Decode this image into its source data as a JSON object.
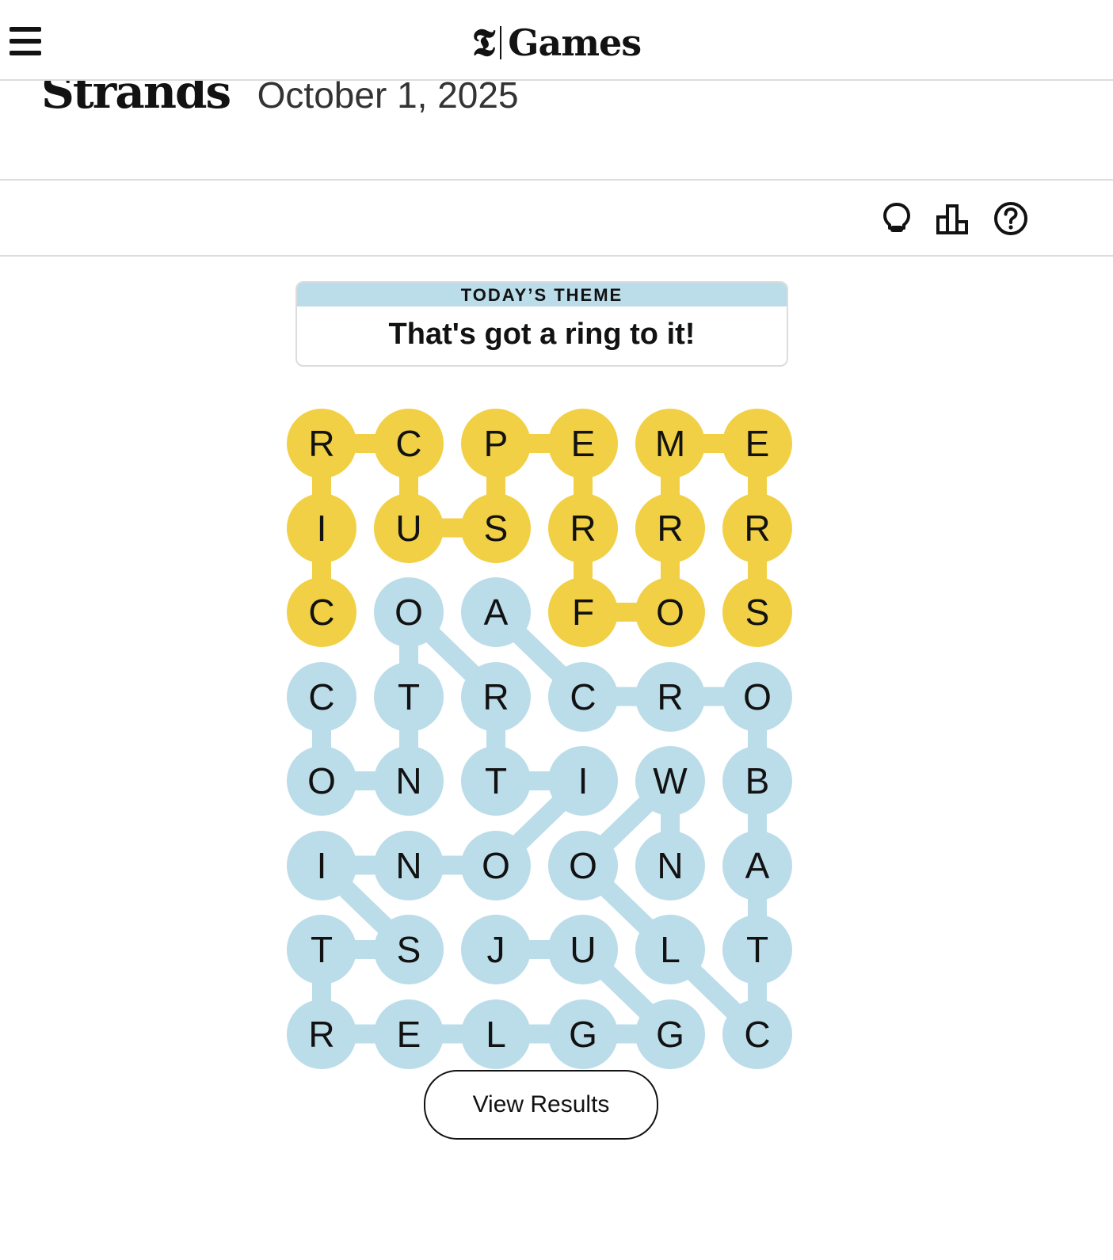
{
  "header": {
    "brand_mark": "𝕿",
    "brand_name": "Games",
    "menu_icon": "hamburger-menu-icon"
  },
  "game": {
    "title": "Strands",
    "date": "October 1, 2025"
  },
  "toolbar": {
    "icons": [
      "hint-lightbulb-icon",
      "stats-podium-icon",
      "help-question-icon"
    ]
  },
  "theme": {
    "label": "TODAY’S THEME",
    "text": "That's got a ring to it!"
  },
  "grid": {
    "rows": [
      [
        "R",
        "C",
        "P",
        "E",
        "M",
        "E"
      ],
      [
        "I",
        "U",
        "S",
        "R",
        "R",
        "R"
      ],
      [
        "C",
        "O",
        "A",
        "F",
        "O",
        "S"
      ],
      [
        "C",
        "T",
        "R",
        "C",
        "R",
        "O"
      ],
      [
        "O",
        "N",
        "T",
        "I",
        "W",
        "B"
      ],
      [
        "I",
        "N",
        "O",
        "O",
        "N",
        "A"
      ],
      [
        "T",
        "S",
        "J",
        "U",
        "L",
        "T"
      ],
      [
        "R",
        "E",
        "L",
        "G",
        "G",
        "C"
      ]
    ],
    "found_words": [
      {
        "type": "spangram",
        "path": [
          [
            2,
            0
          ],
          [
            1,
            0
          ],
          [
            0,
            0
          ],
          [
            0,
            1
          ],
          [
            1,
            1
          ],
          [
            1,
            2
          ],
          [
            0,
            2
          ],
          [
            0,
            3
          ],
          [
            1,
            3
          ],
          [
            2,
            3
          ],
          [
            2,
            4
          ],
          [
            1,
            4
          ],
          [
            0,
            4
          ],
          [
            0,
            5
          ],
          [
            1,
            5
          ],
          [
            2,
            5
          ]
        ]
      },
      {
        "type": "theme",
        "path": [
          [
            3,
            0
          ],
          [
            4,
            0
          ],
          [
            4,
            1
          ],
          [
            3,
            1
          ],
          [
            2,
            1
          ],
          [
            3,
            2
          ],
          [
            4,
            2
          ],
          [
            4,
            3
          ],
          [
            5,
            2
          ],
          [
            5,
            1
          ],
          [
            5,
            0
          ],
          [
            6,
            1
          ],
          [
            6,
            0
          ],
          [
            7,
            0
          ]
        ]
      },
      {
        "type": "theme",
        "path": [
          [
            2,
            2
          ],
          [
            3,
            3
          ],
          [
            3,
            4
          ],
          [
            3,
            5
          ],
          [
            4,
            5
          ],
          [
            5,
            5
          ],
          [
            6,
            5
          ],
          [
            7,
            5
          ]
        ]
      },
      {
        "type": "theme",
        "path": [
          [
            4,
            4
          ],
          [
            5,
            3
          ],
          [
            6,
            4
          ],
          [
            7,
            5
          ]
        ]
      },
      {
        "type": "theme",
        "path": [
          [
            7,
            0
          ],
          [
            7,
            1
          ],
          [
            7,
            2
          ],
          [
            7,
            3
          ],
          [
            7,
            4
          ]
        ]
      },
      {
        "type": "theme",
        "path": [
          [
            6,
            2
          ],
          [
            6,
            3
          ],
          [
            7,
            4
          ]
        ]
      },
      {
        "type": "theme",
        "path": [
          [
            4,
            4
          ],
          [
            5,
            4
          ]
        ]
      }
    ],
    "colors": {
      "spangram": "#f1d045",
      "theme": "#bbdce9"
    }
  },
  "results_button": {
    "label": "View Results"
  }
}
